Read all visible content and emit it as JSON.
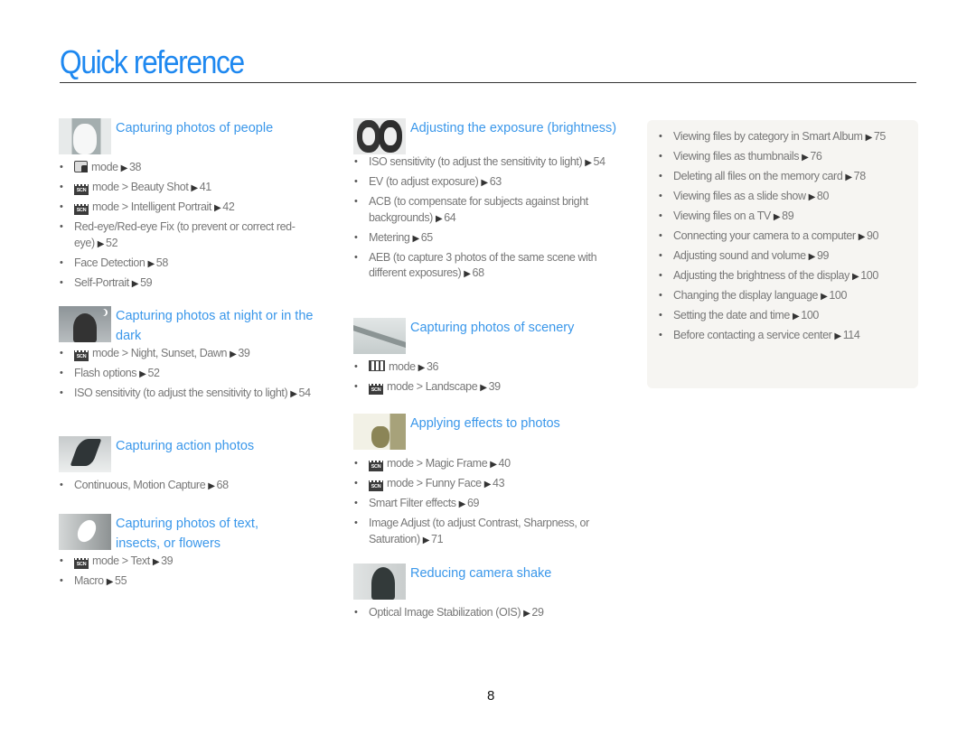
{
  "page": {
    "title": "Quick reference",
    "page_number": "8"
  },
  "arrow": "▶",
  "sections": {
    "people": {
      "title": "Capturing photos of people",
      "thumbnail": "portrait-woman-image",
      "items": [
        {
          "icon": "smart-auto-mode-icon",
          "text": "mode",
          "page": "38"
        },
        {
          "icon": "scene-mode-icon",
          "text": "mode > Beauty Shot",
          "page": "41"
        },
        {
          "icon": "scene-mode-icon",
          "text": "mode > Intelligent Portrait",
          "page": "42"
        },
        {
          "text": "Red-eye/Red-eye Fix (to prevent or correct red-eye)",
          "page": "52"
        },
        {
          "text": "Face Detection",
          "page": "58"
        },
        {
          "text": "Self-Portrait",
          "page": "59"
        }
      ]
    },
    "night": {
      "title": "Capturing photos at night or in the dark",
      "thumbnail": "night-silhouette-image",
      "items": [
        {
          "icon": "scene-mode-icon",
          "text": "mode > Night, Sunset, Dawn",
          "page": "39"
        },
        {
          "text": "Flash options",
          "page": "52"
        },
        {
          "text": "ISO sensitivity (to adjust the sensitivity to light)",
          "page": "54"
        }
      ]
    },
    "action": {
      "title": "Capturing action photos",
      "thumbnail": "snowboarder-image",
      "items": [
        {
          "text": "Continuous, Motion Capture",
          "page": "68"
        }
      ]
    },
    "text_flowers": {
      "title": "Capturing photos of text, insects, or flowers",
      "thumbnail": "flower-image",
      "items": [
        {
          "icon": "scene-mode-icon",
          "text": "mode > Text",
          "page": "39"
        },
        {
          "text": "Macro",
          "page": "55"
        }
      ]
    },
    "exposure": {
      "title": "Adjusting the exposure (brightness)",
      "thumbnail": "couple-faces-image",
      "items": [
        {
          "text": "ISO sensitivity (to adjust the sensitivity to light)",
          "page": "54"
        },
        {
          "text": "EV (to adjust exposure)",
          "page": "63"
        },
        {
          "text": "ACB (to compensate for subjects against bright backgrounds)",
          "page": "64"
        },
        {
          "text": "Metering",
          "page": "65"
        },
        {
          "text": "AEB (to capture 3 photos of the same scene with different exposures)",
          "page": "68"
        }
      ]
    },
    "scenery": {
      "title": "Capturing photos of scenery",
      "thumbnail": "bridge-image",
      "items": [
        {
          "icon": "panorama-mode-icon",
          "text": "mode",
          "page": "36"
        },
        {
          "icon": "scene-mode-icon",
          "text": "mode > Landscape",
          "page": "39"
        }
      ]
    },
    "effects": {
      "title": "Applying effects to photos",
      "thumbnail": "vase-image",
      "items": [
        {
          "icon": "scene-mode-icon",
          "text": "mode > Magic Frame",
          "page": "40"
        },
        {
          "icon": "scene-mode-icon",
          "text": "mode > Funny Face",
          "page": "43"
        },
        {
          "text": "Smart Filter effects",
          "page": "69"
        },
        {
          "text": "Image Adjust (to adjust Contrast, Sharpness, or Saturation)",
          "page": "71"
        }
      ]
    },
    "shake": {
      "title": "Reducing camera shake",
      "thumbnail": "waving-person-image",
      "items": [
        {
          "text": "Optical Image Stabilization (OIS)",
          "page": "29"
        }
      ]
    },
    "panel": {
      "items": [
        {
          "text": "Viewing files by category in Smart Album",
          "page": "75"
        },
        {
          "text": "Viewing files as thumbnails",
          "page": "76"
        },
        {
          "text": "Deleting all files on the memory card",
          "page": "78"
        },
        {
          "text": "Viewing files as a slide show",
          "page": "80"
        },
        {
          "text": "Viewing files on a TV",
          "page": "89"
        },
        {
          "text": "Connecting your camera to a computer",
          "page": "90"
        },
        {
          "text": "Adjusting sound and volume",
          "page": "99"
        },
        {
          "text": "Adjusting the brightness of the display",
          "page": "100"
        },
        {
          "text": "Changing the display language",
          "page": "100"
        },
        {
          "text": "Setting the date and time",
          "page": "100"
        },
        {
          "text": "Before contacting a service center",
          "page": "114"
        }
      ]
    }
  },
  "icons": {
    "scene_label": "SCN"
  },
  "colors": {
    "title": "#1e88f0",
    "section_heading": "#3a97ea",
    "body_text": "#777777",
    "panel_bg": "#f6f5f2"
  }
}
